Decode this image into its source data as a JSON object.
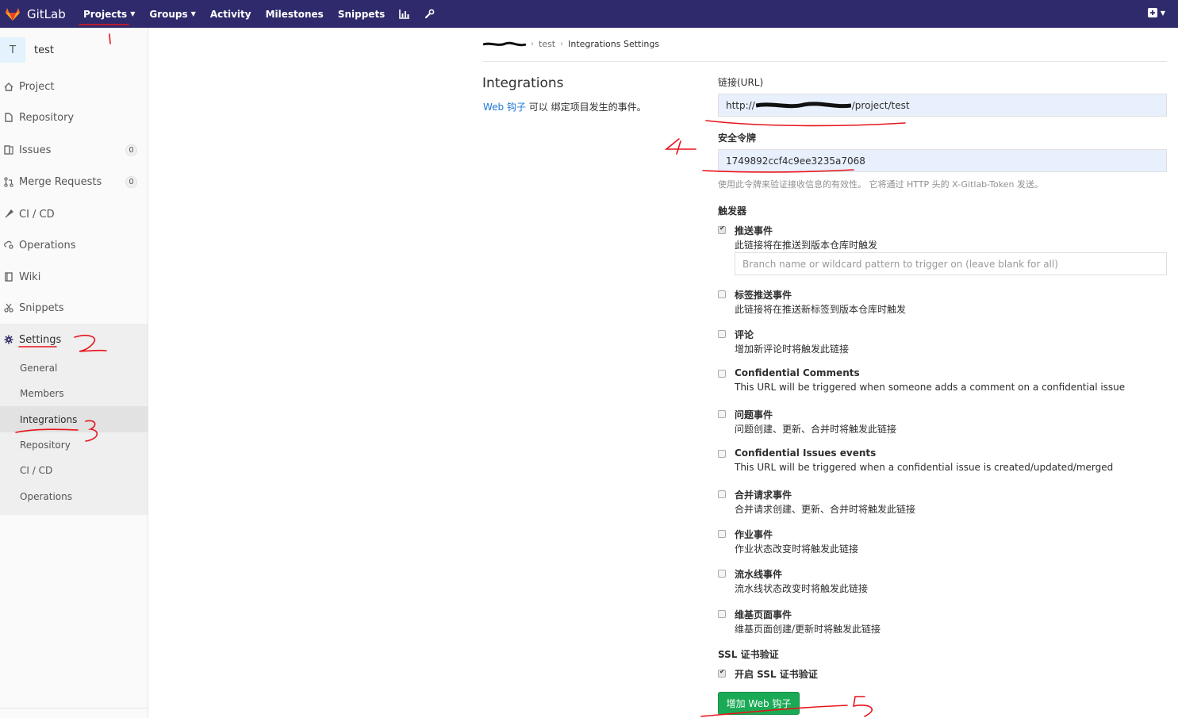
{
  "navbar": {
    "brand": "GitLab",
    "items": [
      {
        "label": "Projects",
        "caret": true
      },
      {
        "label": "Groups",
        "caret": true
      },
      {
        "label": "Activity",
        "caret": false
      },
      {
        "label": "Milestones",
        "caret": false
      },
      {
        "label": "Snippets",
        "caret": false
      }
    ],
    "icons": [
      "chart-icon",
      "wrench-icon"
    ],
    "right_icon": "plus-square-icon",
    "brand_color": "#2f2a6b"
  },
  "sidebar": {
    "avatar_letter": "T",
    "project_name": "test",
    "items": [
      {
        "label": "Project",
        "icon": "home-icon"
      },
      {
        "label": "Repository",
        "icon": "doc-icon"
      },
      {
        "label": "Issues",
        "icon": "issues-icon",
        "badge": "0"
      },
      {
        "label": "Merge Requests",
        "icon": "merge-icon",
        "badge": "0"
      },
      {
        "label": "CI / CD",
        "icon": "rocket-icon"
      },
      {
        "label": "Operations",
        "icon": "cloud-gear-icon"
      },
      {
        "label": "Wiki",
        "icon": "book-icon"
      },
      {
        "label": "Snippets",
        "icon": "scissors-icon"
      },
      {
        "label": "Settings",
        "icon": "gear-icon"
      }
    ],
    "settings_sub": [
      "General",
      "Members",
      "Integrations",
      "Repository",
      "CI / CD",
      "Operations"
    ]
  },
  "breadcrumb": {
    "items": [
      "test",
      "Integrations Settings"
    ]
  },
  "intro": {
    "title": "Integrations",
    "desc_link": "Web 钩子",
    "desc_rest": " 可以 绑定项目发生的事件。"
  },
  "form": {
    "url_label": "链接(URL)",
    "url_prefix": "http://",
    "url_suffix": "/project/test",
    "token_label": "安全令牌",
    "token_value": "1749892ccf4c9ee3235a7068",
    "token_hint": "使用此令牌来验证接收信息的有效性。 它将通过 HTTP 头的 X-Gitlab-Token 发送。",
    "trigger_label": "触发器",
    "branch_placeholder": "Branch name or wildcard pattern to trigger on (leave blank for all)",
    "triggers": [
      {
        "title": "推送事件",
        "desc": "此链接将在推送到版本仓库时触发",
        "checked": true
      },
      {
        "title": "标签推送事件",
        "desc": "此链接将在推送新标签到版本仓库时触发",
        "checked": false
      },
      {
        "title": "评论",
        "desc": "增加新评论时将触发此链接",
        "checked": false
      },
      {
        "title": "Confidential Comments",
        "desc": "This URL will be triggered when someone adds a comment on a confidential issue",
        "checked": false
      },
      {
        "title": "问题事件",
        "desc": "问题创建、更新、合并时将触发此链接",
        "checked": false
      },
      {
        "title": "Confidential Issues events",
        "desc": "This URL will be triggered when a confidential issue is created/updated/merged",
        "checked": false
      },
      {
        "title": "合并请求事件",
        "desc": "合并请求创建、更新、合并时将触发此链接",
        "checked": false
      },
      {
        "title": "作业事件",
        "desc": "作业状态改变时将触发此链接",
        "checked": false
      },
      {
        "title": "流水线事件",
        "desc": "流水线状态改变时将触发此链接",
        "checked": false
      },
      {
        "title": "维基页面事件",
        "desc": "维基页面创建/更新时将触发此链接",
        "checked": false
      }
    ],
    "ssl_label": "SSL 证书验证",
    "ssl_option": "开启 SSL 证书验证",
    "ssl_checked": true,
    "submit_label": "增加 Web 钩子",
    "submit_color": "#1aaa55"
  }
}
